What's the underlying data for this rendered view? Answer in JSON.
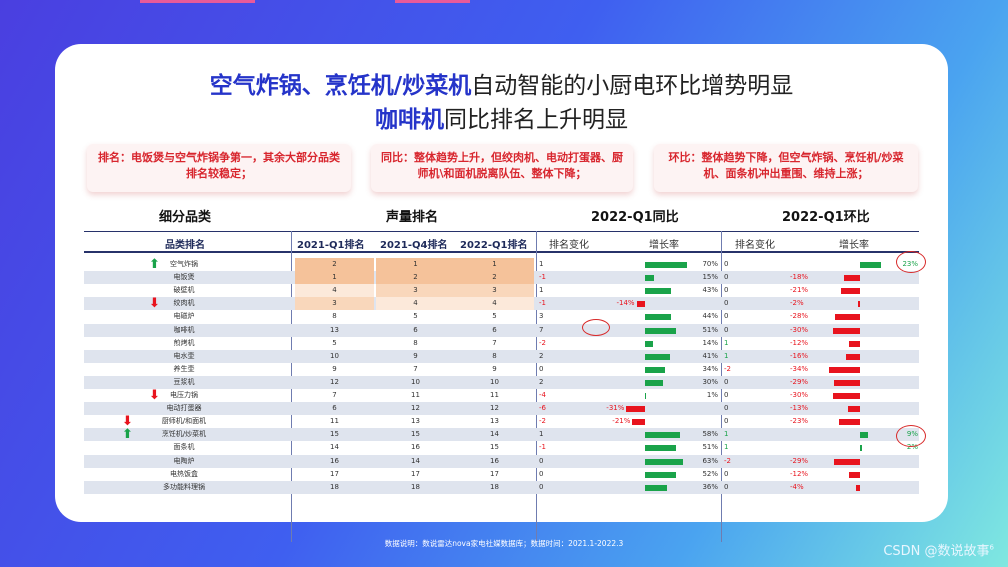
{
  "title": {
    "line1_highlight": "空气炸锅、烹饪机/炒菜机",
    "line1_rest": "自动智能的小厨电环比增势明显",
    "line2_highlight": "咖啡机",
    "line2_rest": "同比排名上升明显"
  },
  "notes": [
    "排名：电饭煲与空气炸锅争第一，其余大部分品类排名较稳定；",
    "同比：整体趋势上升，但绞肉机、电动打蛋器、厨师机\\和面机脱离队伍、整体下降；",
    "环比：整体趋势下降，但空气炸锅、烹饪机/炒菜机、面条机冲出重围、维持上涨；"
  ],
  "sections": [
    "细分品类",
    "声量排名",
    "2022-Q1同比",
    "2022-Q1环比"
  ],
  "headers": {
    "category": "品类排名",
    "q1_2021": "2021-Q1排名",
    "q4_2021": "2021-Q4排名",
    "q1_2022": "2022-Q1排名",
    "yoy_rank": "排名变化",
    "yoy_growth": "增长率",
    "qoq_rank": "排名变化",
    "qoq_growth": "增长率"
  },
  "rows": [
    {
      "name": "空气炸锅",
      "r1": "2",
      "r2": "1",
      "r3": "1",
      "yc": "1",
      "yg": "70%",
      "yv": 70,
      "qc": "0",
      "qg": "23%",
      "qv": 23,
      "arrow": "up"
    },
    {
      "name": "电饭煲",
      "r1": "1",
      "r2": "2",
      "r3": "2",
      "yc": "-1",
      "yg": "15%",
      "yv": 15,
      "qc": "0",
      "qg": "-18%",
      "qv": -18
    },
    {
      "name": "破壁机",
      "r1": "4",
      "r2": "3",
      "r3": "3",
      "yc": "1",
      "yg": "43%",
      "yv": 43,
      "qc": "0",
      "qg": "-21%",
      "qv": -21
    },
    {
      "name": "绞肉机",
      "r1": "3",
      "r2": "4",
      "r3": "4",
      "yc": "-1",
      "yg": "-14%",
      "yv": -14,
      "qc": "0",
      "qg": "-2%",
      "qv": -2,
      "arrow": "down"
    },
    {
      "name": "电磁炉",
      "r1": "8",
      "r2": "5",
      "r3": "5",
      "yc": "3",
      "yg": "44%",
      "yv": 44,
      "qc": "0",
      "qg": "-28%",
      "qv": -28
    },
    {
      "name": "咖啡机",
      "r1": "13",
      "r2": "6",
      "r3": "6",
      "yc": "7",
      "yg": "51%",
      "yv": 51,
      "qc": "0",
      "qg": "-30%",
      "qv": -30
    },
    {
      "name": "煎烤机",
      "r1": "5",
      "r2": "8",
      "r3": "7",
      "yc": "-2",
      "yg": "14%",
      "yv": 14,
      "qc": "1",
      "qg": "-12%",
      "qv": -12
    },
    {
      "name": "电水壶",
      "r1": "10",
      "r2": "9",
      "r3": "8",
      "yc": "2",
      "yg": "41%",
      "yv": 41,
      "qc": "1",
      "qg": "-16%",
      "qv": -16
    },
    {
      "name": "养生壶",
      "r1": "9",
      "r2": "7",
      "r3": "9",
      "yc": "0",
      "yg": "34%",
      "yv": 34,
      "qc": "-2",
      "qg": "-34%",
      "qv": -34
    },
    {
      "name": "豆浆机",
      "r1": "12",
      "r2": "10",
      "r3": "10",
      "yc": "2",
      "yg": "30%",
      "yv": 30,
      "qc": "0",
      "qg": "-29%",
      "qv": -29
    },
    {
      "name": "电压力锅",
      "r1": "7",
      "r2": "11",
      "r3": "11",
      "yc": "-4",
      "yg": "1%",
      "yv": 1,
      "qc": "0",
      "qg": "-30%",
      "qv": -30,
      "arrow": "down"
    },
    {
      "name": "电动打蛋器",
      "r1": "6",
      "r2": "12",
      "r3": "12",
      "yc": "-6",
      "yg": "-31%",
      "yv": -31,
      "qc": "0",
      "qg": "-13%",
      "qv": -13
    },
    {
      "name": "厨师机/和面机",
      "r1": "11",
      "r2": "13",
      "r3": "13",
      "yc": "-2",
      "yg": "-21%",
      "yv": -21,
      "qc": "0",
      "qg": "-23%",
      "qv": -23,
      "arrow": "down"
    },
    {
      "name": "烹饪机/炒菜机",
      "r1": "15",
      "r2": "15",
      "r3": "14",
      "yc": "1",
      "yg": "58%",
      "yv": 58,
      "qc": "1",
      "qg": "9%",
      "qv": 9,
      "arrow": "up"
    },
    {
      "name": "面条机",
      "r1": "14",
      "r2": "16",
      "r3": "15",
      "yc": "-1",
      "yg": "51%",
      "yv": 51,
      "qc": "1",
      "qg": "2%",
      "qv": 2
    },
    {
      "name": "电陶炉",
      "r1": "16",
      "r2": "14",
      "r3": "16",
      "yc": "0",
      "yg": "63%",
      "yv": 63,
      "qc": "-2",
      "qg": "-29%",
      "qv": -29
    },
    {
      "name": "电热饭盒",
      "r1": "17",
      "r2": "17",
      "r3": "17",
      "yc": "0",
      "yg": "52%",
      "yv": 52,
      "qc": "0",
      "qg": "-12%",
      "qv": -12
    },
    {
      "name": "多功能料理锅",
      "r1": "18",
      "r2": "18",
      "r3": "18",
      "yc": "0",
      "yg": "36%",
      "yv": 36,
      "qc": "0",
      "qg": "-4%",
      "qv": -4
    }
  ],
  "footer": "数据说明：数说雷达nova家电社媒数据库；数据时间：2021.1-2022.3",
  "watermark": "CSDN @数说故事",
  "watermark_sup": "6",
  "colors": {
    "accent": "#2534c9",
    "up": "#1aa34a",
    "down": "#e8141e",
    "heat_dark": "#f5c29a",
    "heat_mid": "#f9d7bb",
    "heat_light": "#fce9da"
  }
}
